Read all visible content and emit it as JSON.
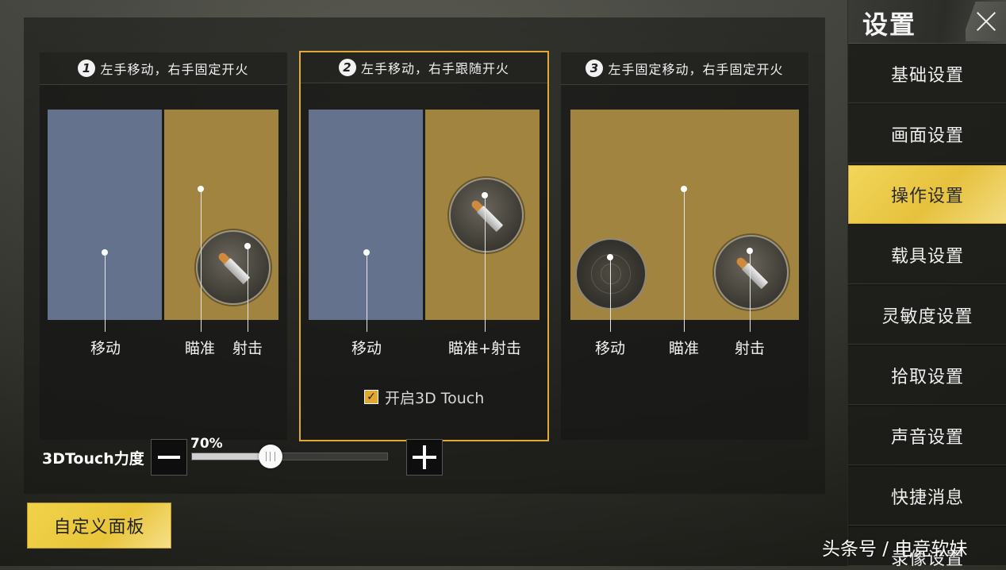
{
  "modes": [
    {
      "number": "1",
      "title": "左手移动，右手固定开火",
      "labels": [
        "移动",
        "瞄准",
        "射击"
      ]
    },
    {
      "number": "2",
      "title": "左手移动，右手跟随开火",
      "labels": [
        "移动",
        "瞄准+射击"
      ],
      "checkbox_label": "开启3D Touch",
      "checkbox_checked": true
    },
    {
      "number": "3",
      "title": "左手固定移动，右手固定开火",
      "labels": [
        "移动",
        "瞄准",
        "射击"
      ]
    }
  ],
  "selected_mode": 2,
  "touch": {
    "label": "3DTouch力度",
    "value_text": "70%",
    "value": 0.4
  },
  "custom_panel_label": "自定义面板",
  "sidebar": {
    "title": "设置",
    "items": [
      {
        "label": "基础设置"
      },
      {
        "label": "画面设置"
      },
      {
        "label": "操作设置",
        "active": true
      },
      {
        "label": "载具设置"
      },
      {
        "label": "灵敏度设置"
      },
      {
        "label": "拾取设置"
      },
      {
        "label": "声音设置"
      },
      {
        "label": "快捷消息"
      },
      {
        "label": "录像设置"
      }
    ]
  },
  "watermark": "头条号 / 电竞软妹",
  "colors": {
    "accent": "#e2a935",
    "move_zone": "#64728d",
    "aim_zone": "#a1843f",
    "button_gold": "#f0d34a"
  }
}
